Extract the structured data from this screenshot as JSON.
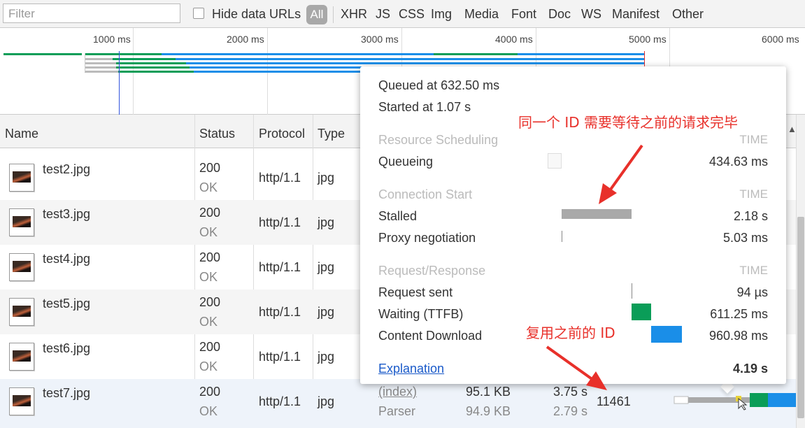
{
  "toolbar": {
    "filter_placeholder": "Filter",
    "hide_data_urls": "Hide data URLs",
    "types": [
      "All",
      "XHR",
      "JS",
      "CSS",
      "Img",
      "Media",
      "Font",
      "Doc",
      "WS",
      "Manifest",
      "Other"
    ]
  },
  "overview": {
    "ticks": [
      "1000 ms",
      "2000 ms",
      "3000 ms",
      "4000 ms",
      "5000 ms",
      "6000 ms"
    ]
  },
  "columns": {
    "name": "Name",
    "status": "Status",
    "protocol": "Protocol",
    "type": "Type"
  },
  "rows": [
    {
      "name": "test2.jpg",
      "status": "200",
      "status_text": "OK",
      "protocol": "http/1.1",
      "type": "jpg"
    },
    {
      "name": "test3.jpg",
      "status": "200",
      "status_text": "OK",
      "protocol": "http/1.1",
      "type": "jpg"
    },
    {
      "name": "test4.jpg",
      "status": "200",
      "status_text": "OK",
      "protocol": "http/1.1",
      "type": "jpg"
    },
    {
      "name": "test5.jpg",
      "status": "200",
      "status_text": "OK",
      "protocol": "http/1.1",
      "type": "jpg"
    },
    {
      "name": "test6.jpg",
      "status": "200",
      "status_text": "OK",
      "protocol": "http/1.1",
      "type": "jpg"
    },
    {
      "name": "test7.jpg",
      "status": "200",
      "status_text": "OK",
      "protocol": "http/1.1",
      "type": "jpg",
      "initiator": "(index)",
      "initiator_sub": "Parser",
      "size": "95.1 KB",
      "size_sub": "94.9 KB",
      "time": "3.75 s",
      "time_sub": "2.79 s",
      "connection_id": "11461"
    }
  ],
  "timing": {
    "queued": "Queued at 632.50 ms",
    "started": "Started at 1.07 s",
    "sec_scheduling": "Resource Scheduling",
    "sec_connection": "Connection Start",
    "sec_request": "Request/Response",
    "time_header": "TIME",
    "queueing_label": "Queueing",
    "queueing_value": "434.63 ms",
    "stalled_label": "Stalled",
    "stalled_value": "2.18 s",
    "proxy_label": "Proxy negotiation",
    "proxy_value": "5.03 ms",
    "request_sent_label": "Request sent",
    "request_sent_value": "94 µs",
    "waiting_label": "Waiting (TTFB)",
    "waiting_value": "611.25 ms",
    "download_label": "Content Download",
    "download_value": "960.98 ms",
    "explanation": "Explanation",
    "total": "4.19 s"
  },
  "annotations": {
    "top": "同一个 ID 需要等待之前的请求完毕",
    "bottom": "复用之前的 ID"
  },
  "colors": {
    "waiting": "#0a9d58",
    "download": "#1a8ee8",
    "stalled": "#a9a9a9",
    "annotation": "#e8302a",
    "link": "#1a5ac9"
  }
}
